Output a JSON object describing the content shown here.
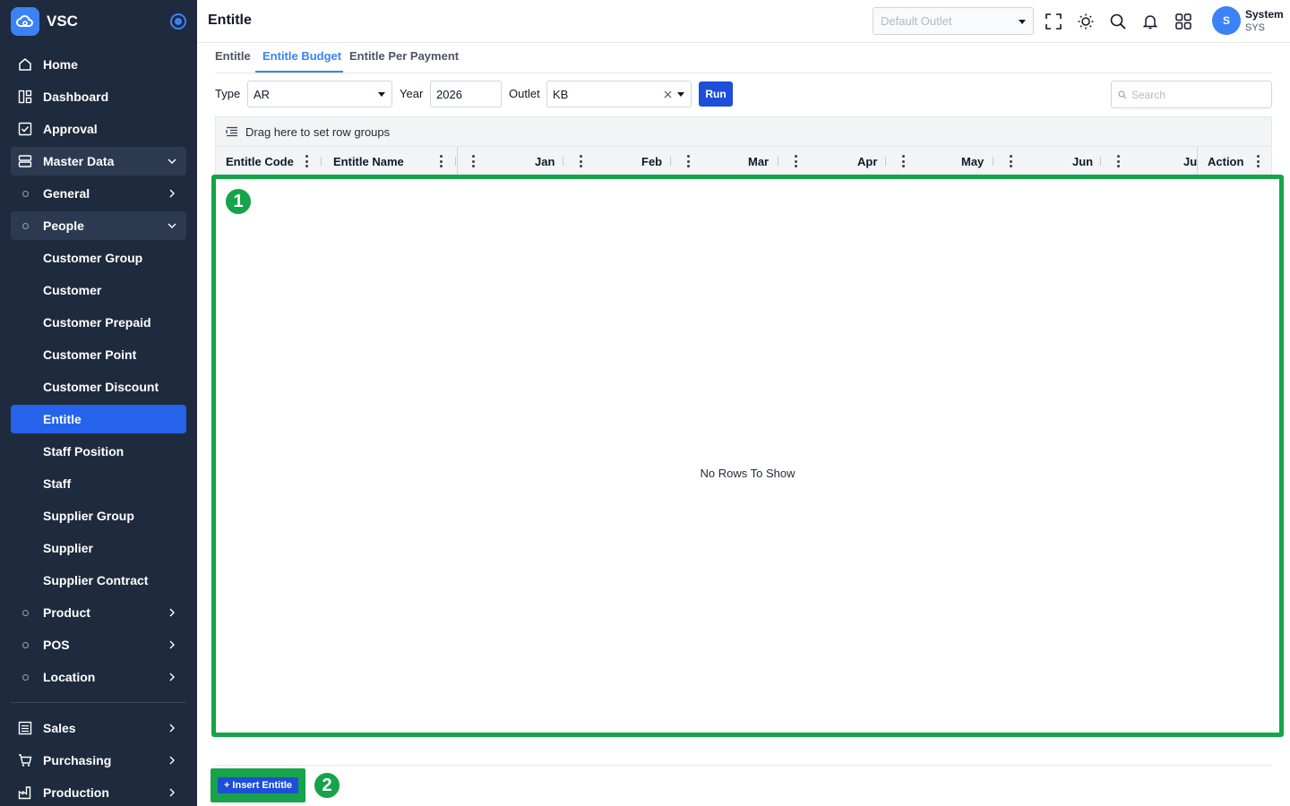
{
  "app": {
    "name": "VSC"
  },
  "sidebar": {
    "items": [
      {
        "label": "Home"
      },
      {
        "label": "Dashboard"
      },
      {
        "label": "Approval"
      },
      {
        "label": "Master Data"
      },
      {
        "label": "General"
      },
      {
        "label": "People"
      },
      {
        "label": "Customer Group"
      },
      {
        "label": "Customer"
      },
      {
        "label": "Customer Prepaid"
      },
      {
        "label": "Customer Point"
      },
      {
        "label": "Customer Discount"
      },
      {
        "label": "Entitle"
      },
      {
        "label": "Staff Position"
      },
      {
        "label": "Staff"
      },
      {
        "label": "Supplier Group"
      },
      {
        "label": "Supplier"
      },
      {
        "label": "Supplier Contract"
      },
      {
        "label": "Product"
      },
      {
        "label": "POS"
      },
      {
        "label": "Location"
      },
      {
        "label": "Sales"
      },
      {
        "label": "Purchasing"
      },
      {
        "label": "Production"
      }
    ]
  },
  "header": {
    "title": "Entitle",
    "outlet_placeholder": "Default Outlet",
    "user_name": "System",
    "user_code": "SYS",
    "avatar_initial": "S"
  },
  "tabs": [
    {
      "label": "Entitle"
    },
    {
      "label": "Entitle Budget"
    },
    {
      "label": "Entitle Per Payment"
    }
  ],
  "filters": {
    "type_label": "Type",
    "type_value": "AR",
    "year_label": "Year",
    "year_value": "2026",
    "outlet_label": "Outlet",
    "outlet_value": "KB",
    "run_label": "Run",
    "search_placeholder": "Search"
  },
  "grid": {
    "group_panel_text": "Drag here to set row groups",
    "columns": [
      "Entitle Code",
      "Entitle Name",
      "Jan",
      "Feb",
      "Mar",
      "Apr",
      "May",
      "Jun",
      "Ju",
      "Action"
    ],
    "empty_text": "No Rows To Show"
  },
  "annotations": {
    "badge_1": "1",
    "badge_2": "2"
  },
  "footer": {
    "insert_label": "+ Insert Entitle"
  },
  "colors": {
    "sidebar_bg": "#1e2a3d",
    "accent": "#2563eb",
    "highlight": "#16a34a"
  }
}
